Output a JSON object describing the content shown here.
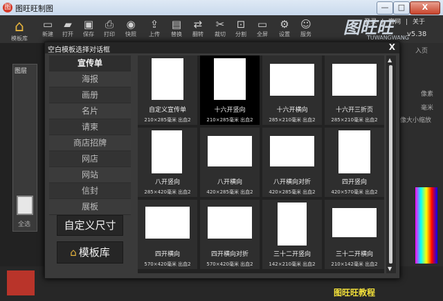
{
  "window": {
    "title": "图旺旺制图",
    "links": [
      "登录",
      "官网",
      "关于"
    ],
    "buttons": [
      "—",
      "□",
      "X"
    ]
  },
  "toolbar": {
    "home_label": "模板库",
    "tools": [
      "新建",
      "打开",
      "保存",
      "打印",
      "快照",
      "上传",
      "替换",
      "翻转",
      "裁切",
      "分割",
      "全屏",
      "设置",
      "服务"
    ]
  },
  "brand": {
    "logo": "图旺旺",
    "english": "TUWANGWANG",
    "version": "v5.38"
  },
  "background": {
    "layers_label": "图层",
    "all_label": "全选",
    "pixel_label": "像素",
    "mm_label": "毫米",
    "scale_label": "像大小缩放",
    "enter_page_label": "入页",
    "tutorial": "图旺旺教程"
  },
  "dialog": {
    "title": "空白模板选择对话框",
    "close": "X",
    "categories": [
      "宣传单",
      "海报",
      "画册",
      "名片",
      "请柬",
      "商店招牌",
      "网店",
      "网站",
      "信封",
      "展板"
    ],
    "custom_size": "自定义尺寸",
    "template_library": "模板库",
    "templates": [
      {
        "name": "自定义宣传单",
        "size": "210×285毫米 出血2"
      },
      {
        "name": "十六开竖向",
        "size": "210×285毫米 出血2"
      },
      {
        "name": "十六开横向",
        "size": "285×210毫米 出血2"
      },
      {
        "name": "十六开三折页",
        "size": "285×210毫米 出血2"
      },
      {
        "name": "八开竖向",
        "size": "285×420毫米 出血2"
      },
      {
        "name": "八开横向",
        "size": "420×285毫米 出血2"
      },
      {
        "name": "八开横向对折",
        "size": "420×285毫米 出血2"
      },
      {
        "name": "四开竖向",
        "size": "420×570毫米 出血2"
      },
      {
        "name": "四开横向",
        "size": "570×420毫米 出血2"
      },
      {
        "name": "四开横向对折",
        "size": "570×420毫米 出血2"
      },
      {
        "name": "三十二开竖向",
        "size": "142×210毫米 出血2"
      },
      {
        "name": "三十二开横向",
        "size": "210×142毫米 出血2"
      }
    ]
  },
  "colors": {
    "accent": "#f5e23a",
    "dialog_bg": "#3a3a3a",
    "selected_card": "#000000"
  }
}
